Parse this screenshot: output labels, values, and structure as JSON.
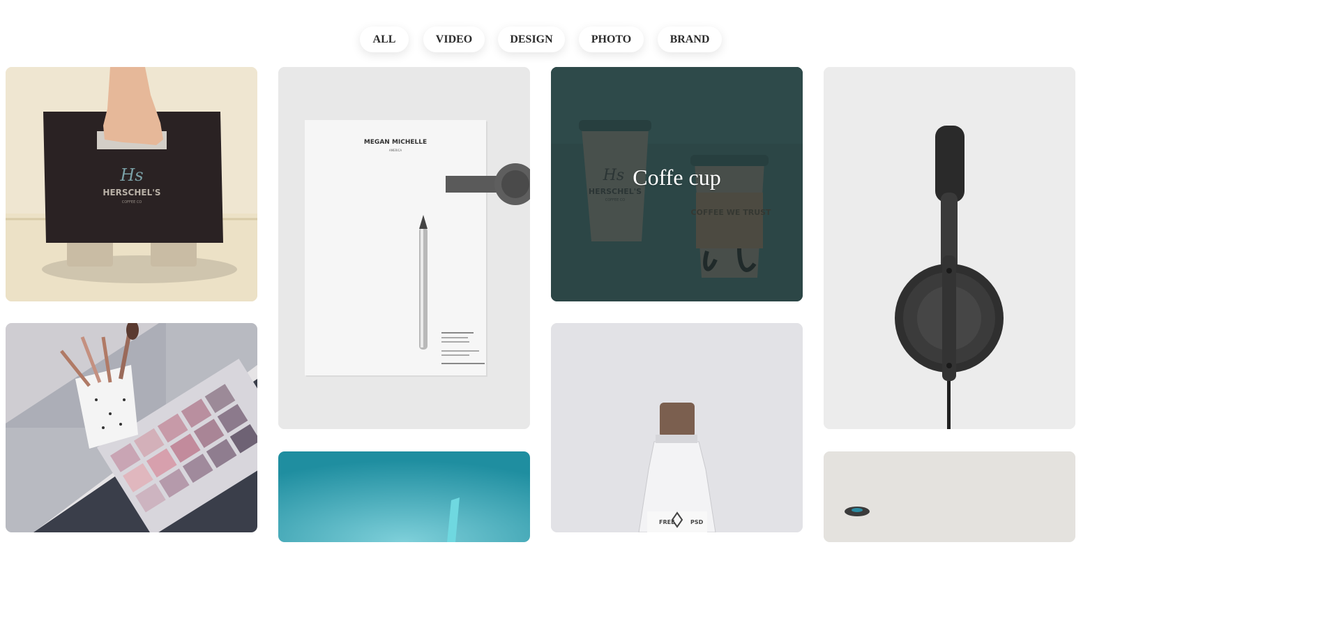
{
  "filters": [
    {
      "label": "ALL"
    },
    {
      "label": "VIDEO"
    },
    {
      "label": "DESIGN"
    },
    {
      "label": "PHOTO"
    },
    {
      "label": "BRAND"
    }
  ],
  "cards": {
    "coffee_carrier": {
      "logo_text": "HERSCHEL'S",
      "sub_text": "COFFEE CO"
    },
    "letterhead": {
      "name": "MEGAN MICHELLE",
      "sub": "AMERICA"
    },
    "coffee_cup": {
      "overlay_title": "Coffe cup",
      "logo_text": "HERSCHEL'S",
      "sub_text": "COFFEE CO",
      "sleeve_text": "COFFEE WE TRUST"
    },
    "bottle": {
      "label_left": "FREE",
      "label_right": "PSD"
    }
  },
  "colors": {
    "coffee_overlay": "#2f4a4a",
    "teal_card": "#2a9aaa"
  }
}
